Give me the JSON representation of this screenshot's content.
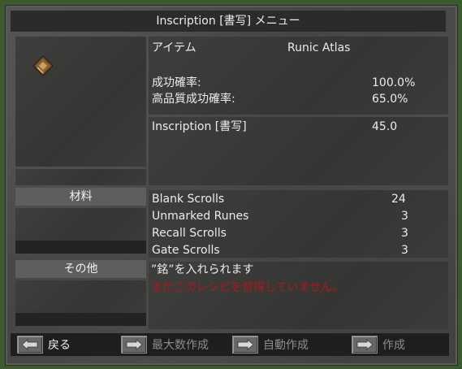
{
  "window": {
    "title": "Inscription [書写] メニュー"
  },
  "item": {
    "header_label": "アイテム",
    "name": "Runic Atlas",
    "icon": "runic-atlas-book-icon"
  },
  "chances": [
    {
      "label": "成功確率:",
      "value": "100.0%"
    },
    {
      "label": "高品質成功確率:",
      "value": "65.0%"
    }
  ],
  "skill": {
    "name": "Inscription [書写]",
    "value": "45.0"
  },
  "materials": {
    "section_label": "材料",
    "items": [
      {
        "name": "Blank Scrolls",
        "qty": "24"
      },
      {
        "name": "Unmarked Runes",
        "qty": "3"
      },
      {
        "name": "Recall Scrolls",
        "qty": "3"
      },
      {
        "name": "Gate Scrolls",
        "qty": "3"
      }
    ]
  },
  "other": {
    "section_label": "その他",
    "note": "”銘”を入れられます",
    "warning": "まだこのレシピを習得していません。"
  },
  "buttons": {
    "back": "戻る",
    "make_max": "最大数作成",
    "auto_make": "自動作成",
    "make": "作成"
  },
  "colors": {
    "warning": "#b01818",
    "disabled_text": "#8c8c8a"
  }
}
